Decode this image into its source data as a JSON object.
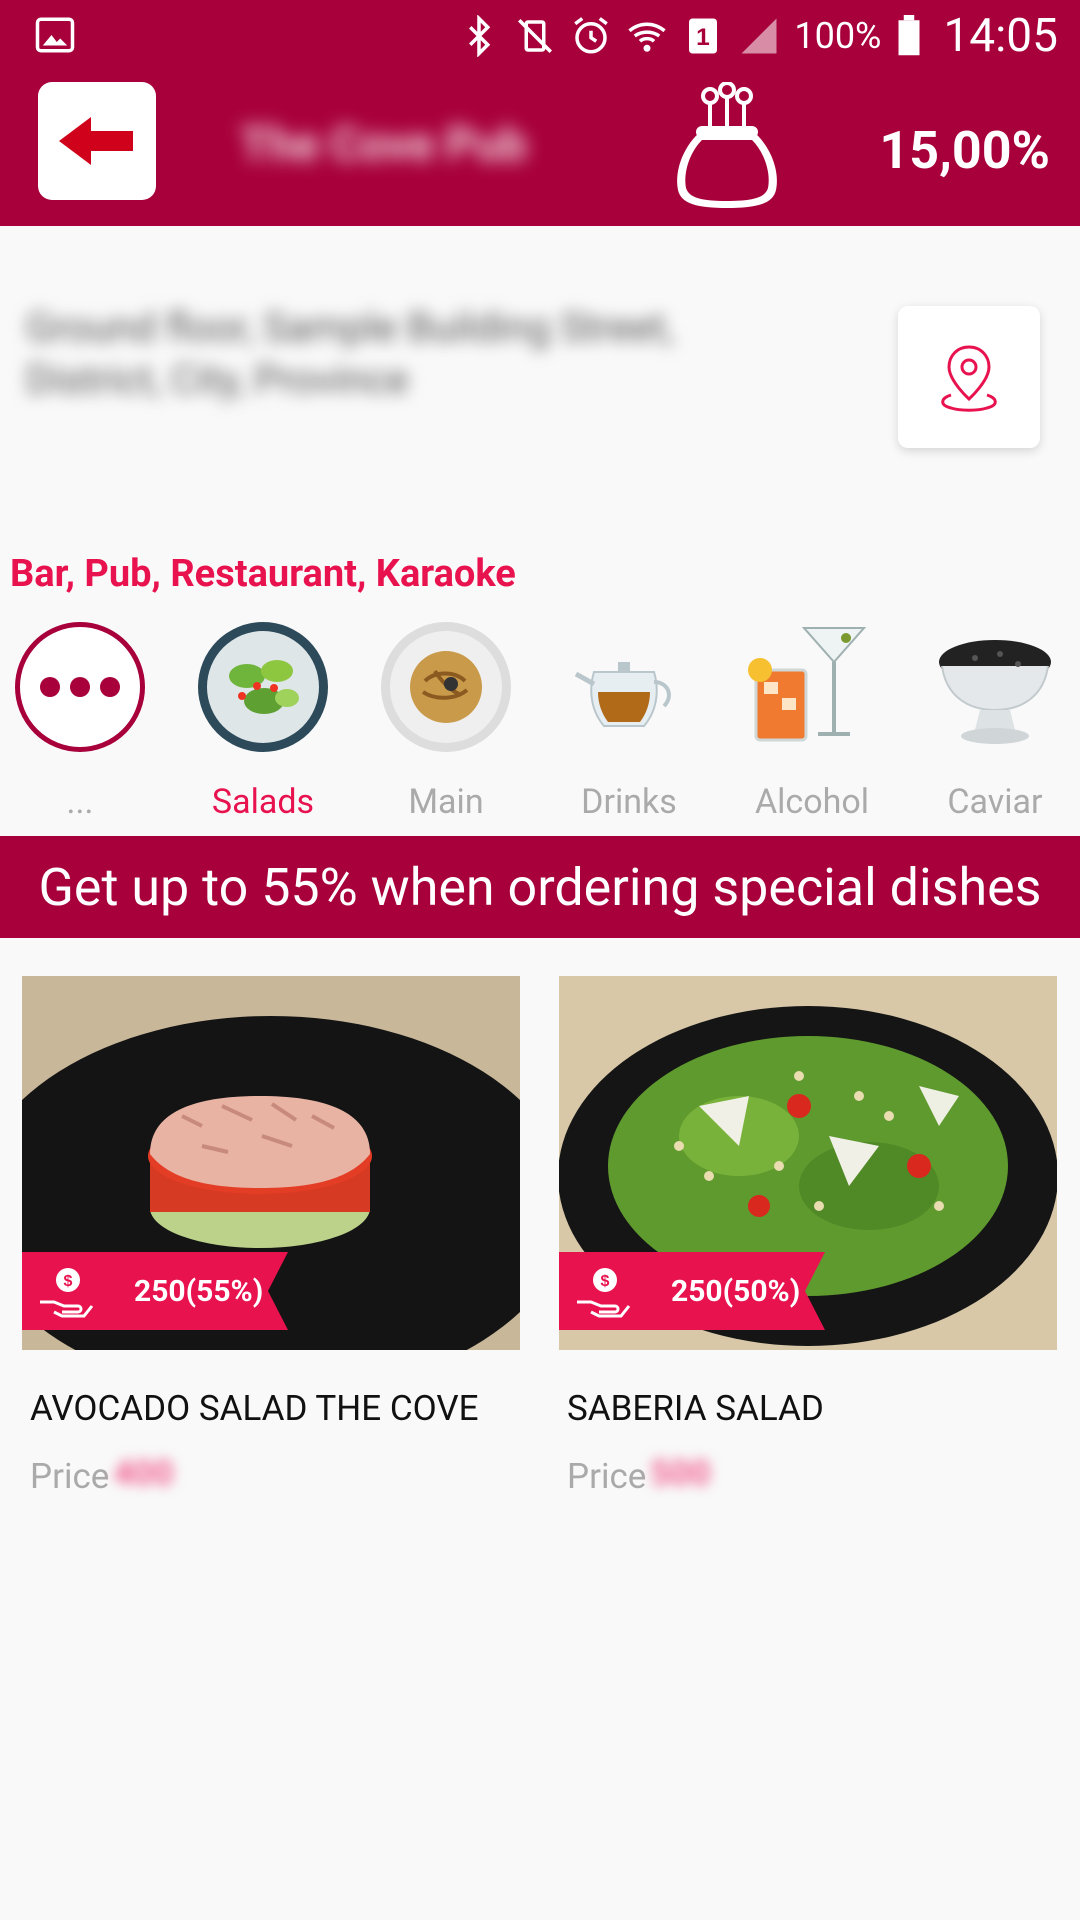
{
  "status_bar": {
    "battery": "100%",
    "time": "14:05",
    "sim_slot": "1"
  },
  "header": {
    "venue_name": "The Cove Pub",
    "cashback": "15,00%"
  },
  "address": {
    "text": "Ground floor, Sample Building Street, District, City, Province"
  },
  "categories_title": "Bar, Pub, Restaurant, Karaoke",
  "categories": [
    {
      "label": "...",
      "icon": "more-icon"
    },
    {
      "label": "Salads",
      "icon": "salad-icon"
    },
    {
      "label": "Main",
      "icon": "pasta-icon"
    },
    {
      "label": "Drinks",
      "icon": "teapot-icon"
    },
    {
      "label": "Alcohol",
      "icon": "cocktail-icon"
    },
    {
      "label": "Caviar",
      "icon": "caviar-icon"
    }
  ],
  "promo_banner": "Get up to 55% when ordering special dishes",
  "dishes": [
    {
      "title": "AVOCADO SALAD THE COVE",
      "badge": "250(55%)",
      "price_label": "Price",
      "price_value": "400"
    },
    {
      "title": "SABERIA SALAD",
      "badge": "250(50%)",
      "price_label": "Price",
      "price_value": "500"
    }
  ],
  "colors": {
    "primary": "#a8003a",
    "accent": "#e8124f"
  }
}
